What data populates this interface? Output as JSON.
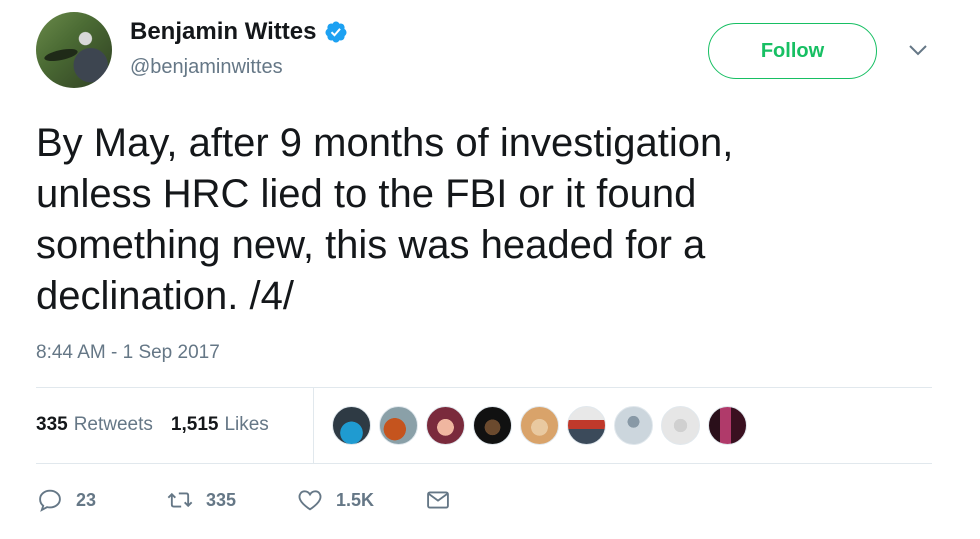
{
  "author": {
    "display_name": "Benjamin Wittes",
    "handle": "@benjaminwittes",
    "verified": true
  },
  "follow_label": "Follow",
  "tweet": {
    "text": "By May, after 9 months of investigation,\nunless HRC lied to the FBI or it found\nsomething new, this was headed for a\ndeclination. /4/",
    "timestamp": "8:44 AM - 1 Sep 2017"
  },
  "stats": {
    "retweets_count": "335",
    "retweets_label": "Retweets",
    "likes_count": "1,515",
    "likes_label": "Likes"
  },
  "actions": {
    "reply_count": "23",
    "retweet_count": "335",
    "like_count": "1.5K"
  },
  "colors": {
    "follow_green": "#17bf63",
    "verified_blue": "#1da1f2",
    "muted_text": "#657786",
    "divider": "#e1e8ed"
  },
  "likers": [
    {
      "name": "liker-1",
      "bg": "radial-gradient(circle at 50% 70%, #1f9bd1 0 35%, #2e3a44 36%)"
    },
    {
      "name": "liker-2",
      "bg": "radial-gradient(circle at 40% 60%, #c5541e 0 35%, #8aa0a8 36%)"
    },
    {
      "name": "liker-3",
      "bg": "radial-gradient(circle at 50% 55%, #f0b6a0 0 30%, #7a2a3c 31%)"
    },
    {
      "name": "liker-4",
      "bg": "radial-gradient(circle at 50% 55%, #6b4a2e 0 28%, #111111 29%)"
    },
    {
      "name": "liker-5",
      "bg": "radial-gradient(circle at 50% 55%, #e9c9a0 0 30%, #d9a36a 31%)"
    },
    {
      "name": "liker-6",
      "bg": "linear-gradient(180deg, #e8e8e8 0 35%, #c0392b 35% 60%, #3b4a5a 60%)"
    },
    {
      "name": "liker-7",
      "bg": "radial-gradient(circle at 50% 40%, #8899a6 0 20%, #ccd6dd 21%)"
    },
    {
      "name": "liker-8",
      "bg": "radial-gradient(circle at 50% 50%, #d0d0d0 0 25%, #e6e6e6 26%)"
    },
    {
      "name": "liker-9",
      "bg": "linear-gradient(90deg, #2a0f1a 0 30%, #b03a6a 30% 60%, #3a1020 60%)"
    }
  ]
}
